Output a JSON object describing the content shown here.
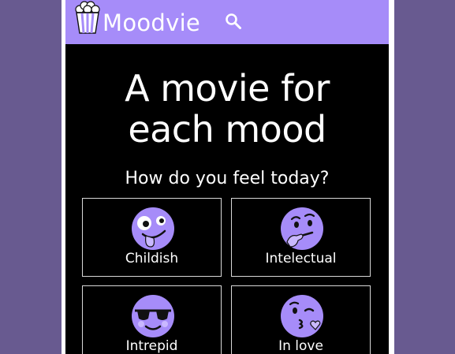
{
  "app": {
    "name": "Moodvie",
    "brand_color": "#a68cf9",
    "background_color": "#000000",
    "backdrop_color": "#685a90"
  },
  "header": {
    "logo_icon": "popcorn-icon",
    "search_icon": "search-icon"
  },
  "hero": {
    "line1": "A movie for",
    "line2": "each mood"
  },
  "prompt": "How do you feel today?",
  "moods": [
    {
      "label": "Childish",
      "icon": "zany-face-icon"
    },
    {
      "label": "Intelectual",
      "icon": "thinking-face-icon"
    },
    {
      "label": "Intrepid",
      "icon": "sunglasses-face-icon"
    },
    {
      "label": "In love",
      "icon": "kissing-face-icon"
    }
  ]
}
